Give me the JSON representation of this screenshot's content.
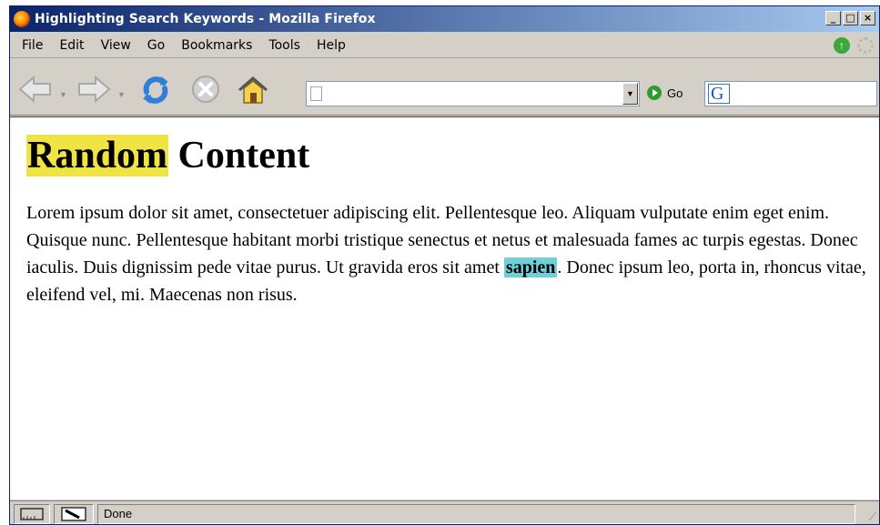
{
  "window": {
    "title": "Highlighting Search Keywords - Mozilla Firefox",
    "controls": {
      "minimize": "_",
      "maximize": "□",
      "close": "×"
    }
  },
  "menu": {
    "items": [
      {
        "label": "File",
        "accel": "F"
      },
      {
        "label": "Edit",
        "accel": "E"
      },
      {
        "label": "View",
        "accel": "V"
      },
      {
        "label": "Go",
        "accel": "G"
      },
      {
        "label": "Bookmarks",
        "accel": "B"
      },
      {
        "label": "Tools",
        "accel": "T"
      },
      {
        "label": "Help",
        "accel": "H"
      }
    ]
  },
  "toolbar": {
    "url_value": "",
    "go_label": "Go",
    "search_value": "",
    "search_engine_letter": "G",
    "icons": [
      "back-icon",
      "forward-icon",
      "reload-icon",
      "stop-icon",
      "home-icon"
    ]
  },
  "page": {
    "heading_highlighted": "Random",
    "heading_rest": " Content",
    "para_before": "Lorem ipsum dolor sit amet, consectetuer adipiscing elit. Pellentesque leo. Aliquam vulputate enim eget enim. Quisque nunc. Pellentesque habitant morbi tristique senectus et netus et malesuada fames ac turpis egestas. Donec iaculis. Duis dignissim pede vitae purus. Ut gravida eros sit amet ",
    "para_highlighted": "sapien",
    "para_after": ". Donec ipsum leo, porta in, rhoncus vitae, eleifend vel, mi. Maecenas non risus.",
    "highlight_colors": {
      "keyword1": "#f0e445",
      "keyword2": "#70d0d8"
    }
  },
  "status": {
    "text": "Done"
  }
}
